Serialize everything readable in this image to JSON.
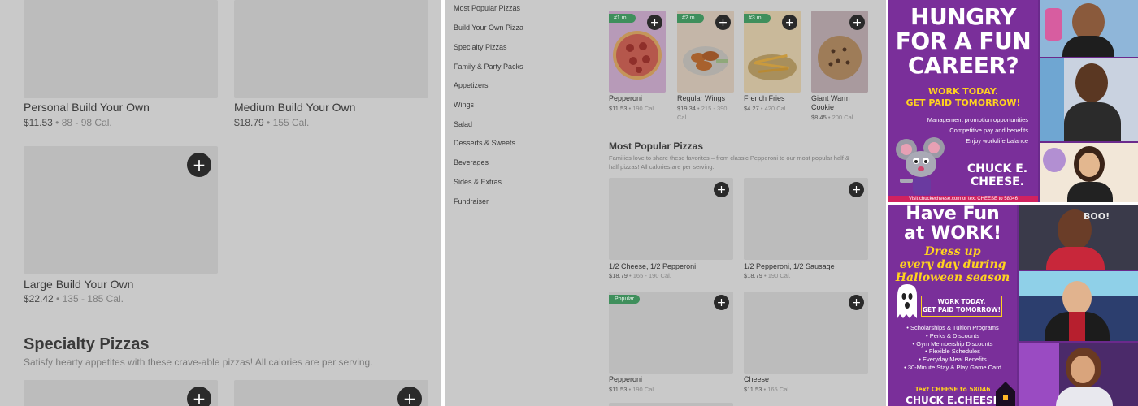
{
  "panel1": {
    "cards": [
      {
        "name": "Personal Build Your Own",
        "price": "$11.53",
        "cal": "88 - 98 Cal."
      },
      {
        "name": "Medium Build Your Own",
        "price": "$18.79",
        "cal": "155 Cal."
      },
      {
        "name": "Large Build Your Own",
        "price": "$22.42",
        "cal": "135 - 185 Cal."
      }
    ],
    "section": {
      "title": "Specialty Pizzas",
      "description": "Satisfy hearty appetites with these crave-able pizzas! All calories are per serving."
    },
    "add_symbol": "+"
  },
  "panel2": {
    "nav": [
      "Most Popular Pizzas",
      "Build Your Own Pizza",
      "Specialty Pizzas",
      "Family & Party Packs",
      "Appetizers",
      "Wings",
      "Salad",
      "Desserts & Sweets",
      "Beverages",
      "Sides & Extras",
      "Fundraiser"
    ],
    "popular_items": [
      {
        "rank": "#1 m...",
        "name": "Pepperoni",
        "price": "$11.53",
        "cal": "190 Cal."
      },
      {
        "rank": "#2 m...",
        "name": "Regular Wings",
        "price": "$19.34",
        "cal": "215 - 390 Cal."
      },
      {
        "rank": "#3 m...",
        "name": "French Fries",
        "price": "$4.27",
        "cal": "420 Cal."
      },
      {
        "rank": "",
        "name": "Giant Warm Cookie",
        "price": "$8.45",
        "cal": "200 Cal."
      }
    ],
    "most_popular": {
      "title": "Most Popular Pizzas",
      "description": "Families love to share these favorites – from classic Pepperoni to our most popular half & half pizzas! All calories are per serving.",
      "items": [
        {
          "name": "1/2 Cheese, 1/2 Pepperoni",
          "price": "$18.79",
          "cal": "165 - 190 Cal.",
          "badge": ""
        },
        {
          "name": "1/2 Pepperoni, 1/2 Sausage",
          "price": "$18.79",
          "cal": "190 Cal.",
          "badge": ""
        },
        {
          "name": "Pepperoni",
          "price": "$11.53",
          "cal": "190 Cal.",
          "badge": "Popular"
        },
        {
          "name": "Cheese",
          "price": "$11.53",
          "cal": "165 Cal.",
          "badge": ""
        }
      ]
    },
    "add_symbol": "+"
  },
  "ad1": {
    "headline_1": "HUNGRY",
    "headline_2": "FOR A FUN",
    "headline_3": "CAREER?",
    "cta_1": "WORK TODAY.",
    "cta_2": "GET PAID TOMORROW!",
    "bullets": [
      "Management promotion opportunities",
      "Competitive pay and benefits",
      "Enjoy work/life balance"
    ],
    "brand_1": "CHUCK E.",
    "brand_2": "CHEESE.",
    "footer": "Visit chuckecheese.com or text CHEESE to 58046"
  },
  "ad2": {
    "headline_1": "Have Fun",
    "headline_2": "at WORK!",
    "sub_1": "Dress up",
    "sub_2": "every day during",
    "sub_3": "Halloween season",
    "cta_1": "WORK TODAY.",
    "cta_2": "GET PAID TOMORROW!",
    "bullets": [
      "• Scholarships & Tuition Programs",
      "• Perks & Discounts",
      "• Gym Membership Discounts",
      "• Flexible Schedules",
      "• Everyday Meal Benefits",
      "• 30-Minute Stay & Play Game Card"
    ],
    "text_line": "Text CHEESE to 58046",
    "brand": "CHUCK E.CHEESE",
    "sign": "BOO!"
  },
  "colors": {
    "overlay_gray": "#c9c9c9",
    "placeholder": "#bcbcbc",
    "badge_green": "#3f8f5c",
    "ad_purple": "#7a2f9a",
    "ad_yellow": "#ffd21f",
    "ad_pink": "#e8246e"
  }
}
